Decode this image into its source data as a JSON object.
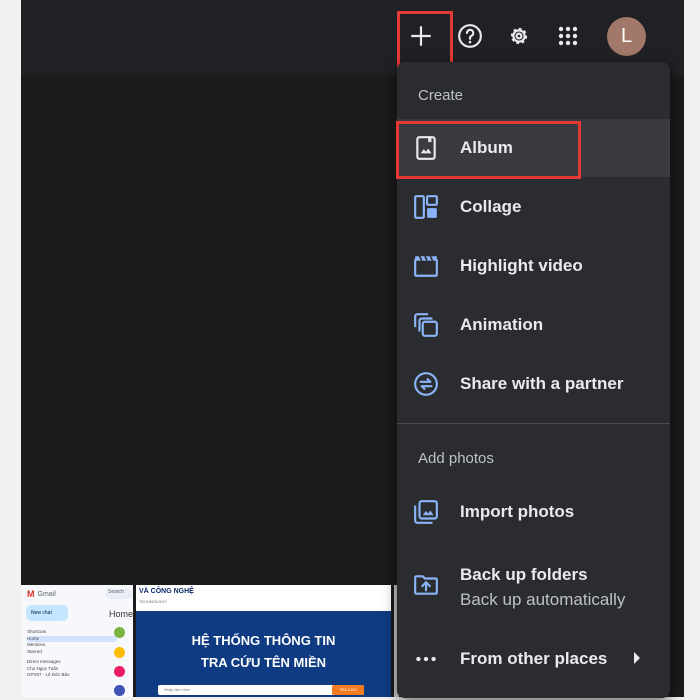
{
  "topbar": {
    "add_icon": "plus-icon",
    "help_icon": "help-circle-icon",
    "settings_icon": "gear-icon",
    "apps_icon": "apps-grid-icon",
    "avatar_initial": "L",
    "avatar_color": "#a1786a"
  },
  "menu": {
    "create_label": "Create",
    "create_items": [
      {
        "label": "Album",
        "icon": "album-icon"
      },
      {
        "label": "Collage",
        "icon": "collage-icon"
      },
      {
        "label": "Highlight video",
        "icon": "clapperboard-icon"
      },
      {
        "label": "Animation",
        "icon": "animation-icon"
      },
      {
        "label": "Share with a partner",
        "icon": "partner-share-icon"
      }
    ],
    "add_photos_label": "Add photos",
    "add_items": [
      {
        "label": "Import photos",
        "icon": "import-photos-icon"
      },
      {
        "label": "Back up folders",
        "sublabel": "Back up automatically",
        "icon": "backup-folder-icon"
      },
      {
        "label": "From other places",
        "icon": "more-horizontal-icon"
      }
    ]
  },
  "thumbnails": {
    "gmail": {
      "brand": "Gmail",
      "search": "Search",
      "new_chat": "New chat",
      "home": "Home",
      "shortcuts": "Shortcuts",
      "items": [
        "Home",
        "Mentions",
        "Starred"
      ],
      "direct_messages": "Direct messages",
      "dms": [
        "Chu Ngọc Tuấn",
        "GPV67 - Lê Đức Bảo"
      ]
    },
    "vn_site": {
      "header_title": "VÀ CÔNG NGHỆ",
      "header_sub": "TECHNOLOGY",
      "title_line1": "HỆ THỐNG THÔNG TIN",
      "title_line2": "TRA CỨU TÊN MIỀN",
      "search_placeholder": "Nhập tên miền",
      "search_button": "TRA CỨU"
    }
  },
  "colors": {
    "highlight": "#e53935",
    "menu_bg": "#2b2c2f",
    "icon_accent": "#8ab4f8"
  }
}
